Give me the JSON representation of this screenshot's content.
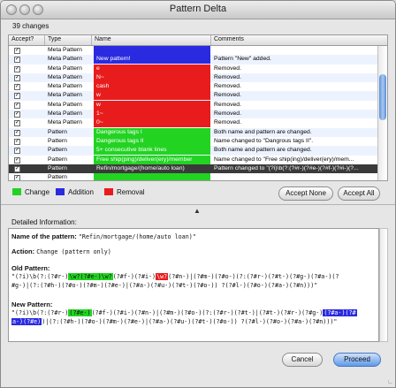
{
  "window": {
    "title": "Pattern Delta"
  },
  "summary": {
    "count": "39 changes"
  },
  "table": {
    "headers": {
      "accept": "Accept?",
      "type": "Type",
      "name": "Name",
      "comments": "Comments"
    },
    "rows": [
      {
        "type": "Meta Pattern",
        "name": "",
        "name_color": "#2a2ae0",
        "comment": ""
      },
      {
        "type": "Meta Pattern",
        "name": "New pattern!",
        "name_color": "#2a2ae0",
        "comment": "Pattern \"New\" added."
      },
      {
        "type": "Meta Pattern",
        "name": "e",
        "name_color": "#e81c1c",
        "comment": "Removed."
      },
      {
        "type": "Meta Pattern",
        "name": "N~",
        "name_color": "#e81c1c",
        "comment": "Removed."
      },
      {
        "type": "Meta Pattern",
        "name": "cash",
        "name_color": "#e81c1c",
        "comment": "Removed."
      },
      {
        "type": "Meta Pattern",
        "name": "w",
        "name_color": "#e81c1c",
        "comment": "Removed."
      },
      {
        "type": "Meta Pattern",
        "name": "w",
        "name_color": "#e81c1c",
        "comment": "Removed."
      },
      {
        "type": "Meta Pattern",
        "name": "1~",
        "name_color": "#e81c1c",
        "comment": "Removed."
      },
      {
        "type": "Meta Pattern",
        "name": "0~",
        "name_color": "#e81c1c",
        "comment": "Removed."
      },
      {
        "type": "Pattern",
        "name": "Dangerous tags I",
        "name_color": "#22d322",
        "comment": "Both name and pattern are changed."
      },
      {
        "type": "Pattern",
        "name": "Dangerous tags II",
        "name_color": "#22d322",
        "comment": "Name changed to \"Dangrous tags II\"."
      },
      {
        "type": "Pattern",
        "name": "5+ consecutive blank lines",
        "name_color": "#22d322",
        "comment": "Both name and pattern are changed."
      },
      {
        "type": "Pattern",
        "name": "Free ship(ping)/deliver(ery)/member",
        "name_color": "#22d322",
        "comment": "Name changed to \"Free ship(ing)/deliver(ery)/mem..."
      },
      {
        "type": "Pattern",
        "name": "Refin/mortgage/(home/auto loan)",
        "name_color": "#3a3a3a",
        "comment": "Pattern changed to \"(?i)\\b(?:(?#r-)(?#e-)(?#f-)(?#i-)(?...",
        "selected": true
      },
      {
        "type": "Pattern",
        "name": "",
        "name_color": "#22d322",
        "comment": ""
      }
    ]
  },
  "legend": {
    "change": {
      "label": "Change",
      "color": "#22d322"
    },
    "addition": {
      "label": "Addition",
      "color": "#2a2ae0"
    },
    "removal": {
      "label": "Removal",
      "color": "#e81c1c"
    }
  },
  "buttons": {
    "accept_none": "Accept None",
    "accept_all": "Accept All",
    "cancel": "Cancel",
    "proceed": "Proceed"
  },
  "detail": {
    "label": "Detailed Information:",
    "name_key": "Name of the pattern:",
    "name_value": "\"Refin/mortgage/(home/auto loan)\"",
    "action_key": "Action:",
    "action_value": "Change (pattern only)",
    "old_title": "Old Pattern:",
    "old_line1": [
      "\"(?i)\\b(?:(?#r-)",
      "\\w?(?#e-)\\w?",
      "(?#f-)(?#i-)",
      "\\w?",
      "(?#n-)|(?#m-)(?#o-)(?:(?#r-)(?#t-)(?#g-)(?#a-)(?"
    ],
    "old_line2": "#g-)|(?:(?#h-)(?#o-)(?#m-)(?#e-)|(?#a-)(?#u-)(?#t-)(?#o-)) ?(?#l-)(?#o-)(?#a-)(?#n)))\"",
    "new_title": "New Pattern:",
    "new_line1": [
      "\"(?i)\\b(?:(?#r-)",
      "(?#e-)",
      "(?#f-)(?#i-)(?#n-)|(?#m-)(?#o-)(?:(?#r-)(?#t-)|(?#t-)(?#r-)(?#g-)",
      "(?#a-)(?#"
    ],
    "new_line2": [
      "a-)(?#e)",
      ")|(?:(?#h-)(?#o-)(?#m-)(?#e-)|(?#a-)(?#u-)(?#t-)(?#o-)) ?(?#l-)(?#o-)(?#a-)(?#n)))\""
    ]
  }
}
